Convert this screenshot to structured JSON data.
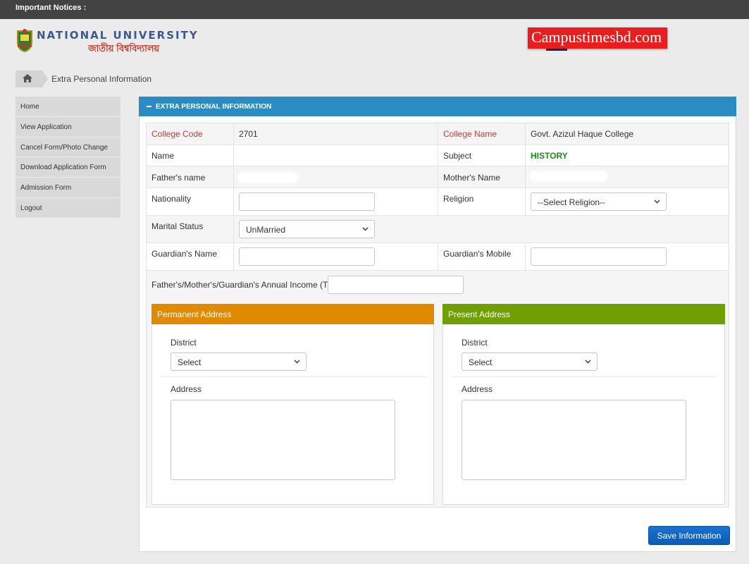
{
  "notice_bar": {
    "label": "Important Notices :"
  },
  "header": {
    "logo_en": "NATIONAL UNIVERSITY",
    "logo_bn": "জাতীয় বিশ্ববিদ্যালয়",
    "watermark": "Campustimesbd.com"
  },
  "breadcrumb": {
    "current": "Extra Personal Information"
  },
  "sidebar": {
    "items": [
      {
        "label": "Home"
      },
      {
        "label": "View Application"
      },
      {
        "label": "Cancel Form/Photo Change"
      },
      {
        "label": "Download Application Form"
      },
      {
        "label": "Admission Form"
      },
      {
        "label": "Logout"
      }
    ]
  },
  "panel": {
    "title": "EXTRA PERSONAL INFORMATION"
  },
  "form": {
    "college_code_label": "College Code",
    "college_code": "2701",
    "college_name_label": "College Name",
    "college_name": "Govt. Azizul Haque College",
    "name_label": "Name",
    "name_value": "",
    "subject_label": "Subject",
    "subject": "HISTORY",
    "father_label": "Father's name",
    "mother_label": "Mother's Name",
    "nationality_label": "Nationality",
    "nationality_value": "",
    "religion_label": "Religion",
    "religion_selected": "--Select Religion--",
    "marital_label": "Marital Status",
    "marital_selected": "UnMarried",
    "guardian_name_label": "Guardian's Name",
    "guardian_name_value": "",
    "guardian_mobile_label": "Guardian's Mobile",
    "guardian_mobile_value": "",
    "income_label": "Father's/Mother's/Guardian's Annual Income (Tk)",
    "income_value": ""
  },
  "permanent_address": {
    "title": "Permanent Address",
    "district_label": "District",
    "district_selected": "Select",
    "address_label": "Address",
    "address_value": "",
    "color": "#e08a00"
  },
  "present_address": {
    "title": "Present Address",
    "district_label": "District",
    "district_selected": "Select",
    "address_label": "Address",
    "address_value": "",
    "color": "#6f9f00"
  },
  "actions": {
    "save_label": "Save Information"
  },
  "colors": {
    "notice_bar": "#434343",
    "panel_header": "#2b8cc4",
    "label_red": "#c23b3b",
    "subject_green": "#1b8a1b",
    "save_button": "#0b5cb5"
  },
  "icons": {
    "home": "home-icon",
    "collapse": "minus-icon",
    "dropdown": "chevron-down-icon"
  }
}
